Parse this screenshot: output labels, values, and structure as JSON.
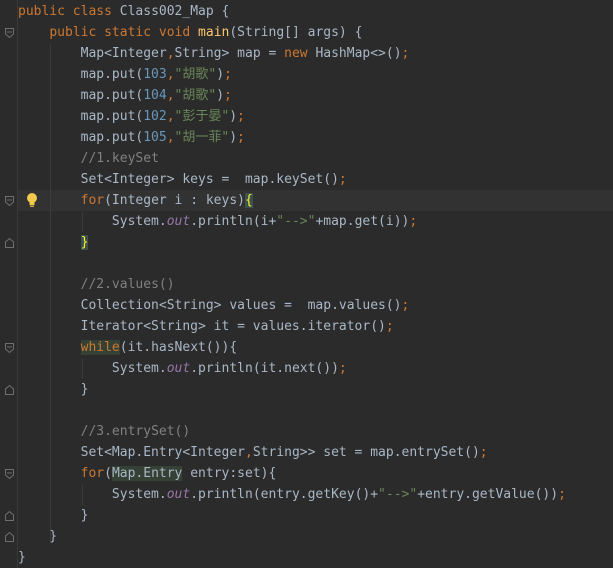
{
  "editor": {
    "lines": [
      [
        {
          "t": "public ",
          "c": "kw"
        },
        {
          "t": "class ",
          "c": "kw"
        },
        {
          "t": "Class002_Map {",
          "c": "df"
        }
      ],
      [
        {
          "t": "    "
        },
        {
          "t": "public ",
          "c": "kw"
        },
        {
          "t": "static ",
          "c": "kw"
        },
        {
          "t": "void ",
          "c": "kw"
        },
        {
          "t": "main",
          "c": "fn"
        },
        {
          "t": "(String[] args) {",
          "c": "df"
        }
      ],
      [
        {
          "t": "        Map<Integer",
          "c": "df"
        },
        {
          "t": ",",
          "c": "kw"
        },
        {
          "t": "String> map = ",
          "c": "df"
        },
        {
          "t": "new ",
          "c": "kw"
        },
        {
          "t": "HashMap<>()",
          "c": "df"
        },
        {
          "t": ";",
          "c": "kw"
        }
      ],
      [
        {
          "t": "        map.put(",
          "c": "df"
        },
        {
          "t": "103",
          "c": "num"
        },
        {
          "t": ",",
          "c": "kw"
        },
        {
          "t": "\"胡歌\"",
          "c": "str"
        },
        {
          "t": ")",
          "c": "df"
        },
        {
          "t": ";",
          "c": "kw"
        }
      ],
      [
        {
          "t": "        map.put(",
          "c": "df"
        },
        {
          "t": "104",
          "c": "num"
        },
        {
          "t": ",",
          "c": "kw"
        },
        {
          "t": "\"胡歌\"",
          "c": "str"
        },
        {
          "t": ")",
          "c": "df"
        },
        {
          "t": ";",
          "c": "kw"
        }
      ],
      [
        {
          "t": "        map.put(",
          "c": "df"
        },
        {
          "t": "102",
          "c": "num"
        },
        {
          "t": ",",
          "c": "kw"
        },
        {
          "t": "\"彭于晏\"",
          "c": "str"
        },
        {
          "t": ")",
          "c": "df"
        },
        {
          "t": ";",
          "c": "kw"
        }
      ],
      [
        {
          "t": "        map.put(",
          "c": "df"
        },
        {
          "t": "105",
          "c": "num"
        },
        {
          "t": ",",
          "c": "kw"
        },
        {
          "t": "\"胡一菲\"",
          "c": "str"
        },
        {
          "t": ")",
          "c": "df"
        },
        {
          "t": ";",
          "c": "kw"
        }
      ],
      [
        {
          "t": "        "
        },
        {
          "t": "//1.keySet",
          "c": "cm"
        }
      ],
      [
        {
          "t": "        Set<Integer> keys =  map.keySet()",
          "c": "df"
        },
        {
          "t": ";",
          "c": "kw"
        }
      ],
      [
        {
          "t": "        "
        },
        {
          "t": "for",
          "c": "kw"
        },
        {
          "t": "(Integer i : keys)",
          "c": "df"
        },
        {
          "t": "{",
          "c": "brace-match"
        }
      ],
      [
        {
          "t": "            System.",
          "c": "df"
        },
        {
          "t": "out",
          "c": "st"
        },
        {
          "t": ".println(i+",
          "c": "df"
        },
        {
          "t": "\"-->\"",
          "c": "str"
        },
        {
          "t": "+map.get(i))",
          "c": "df"
        },
        {
          "t": ";",
          "c": "kw"
        }
      ],
      [
        {
          "t": "        "
        },
        {
          "t": "}",
          "c": "brace-match"
        }
      ],
      [
        {
          "t": ""
        }
      ],
      [
        {
          "t": "        "
        },
        {
          "t": "//2.values()",
          "c": "cm"
        }
      ],
      [
        {
          "t": "        Collection<String> values =  map.values()",
          "c": "df"
        },
        {
          "t": ";",
          "c": "kw"
        }
      ],
      [
        {
          "t": "        Iterator<String> it = values.iterator()",
          "c": "df"
        },
        {
          "t": ";",
          "c": "kw"
        }
      ],
      [
        {
          "t": "        "
        },
        {
          "t": "while",
          "c": "kw usage"
        },
        {
          "t": "(it.hasNext()){",
          "c": "df"
        }
      ],
      [
        {
          "t": "            System.",
          "c": "df"
        },
        {
          "t": "out",
          "c": "st"
        },
        {
          "t": ".println(it.next())",
          "c": "df"
        },
        {
          "t": ";",
          "c": "kw"
        }
      ],
      [
        {
          "t": "        }",
          "c": "df"
        }
      ],
      [
        {
          "t": ""
        }
      ],
      [
        {
          "t": "        "
        },
        {
          "t": "//3.entrySet()",
          "c": "cm"
        }
      ],
      [
        {
          "t": "        Set<Map.Entry<Integer",
          "c": "df"
        },
        {
          "t": ",",
          "c": "kw"
        },
        {
          "t": "String>> set = map.entrySet()",
          "c": "df"
        },
        {
          "t": ";",
          "c": "kw"
        }
      ],
      [
        {
          "t": "        "
        },
        {
          "t": "for",
          "c": "kw"
        },
        {
          "t": "(",
          "c": "df"
        },
        {
          "t": "Map.Entry",
          "c": "df usage"
        },
        {
          "t": " entry:set){",
          "c": "df"
        }
      ],
      [
        {
          "t": "            System.",
          "c": "df"
        },
        {
          "t": "out",
          "c": "st"
        },
        {
          "t": ".println(entry.getKey()+",
          "c": "df"
        },
        {
          "t": "\"-->\"",
          "c": "str"
        },
        {
          "t": "+entry.getValue())",
          "c": "df"
        },
        {
          "t": ";",
          "c": "kw"
        }
      ],
      [
        {
          "t": "        }",
          "c": "df"
        }
      ],
      [
        {
          "t": "    }",
          "c": "df"
        }
      ],
      [
        {
          "t": "}",
          "c": "df"
        }
      ]
    ]
  },
  "gutter": {
    "fold_markers": [
      {
        "line": 1,
        "kind": "open"
      },
      {
        "line": 9,
        "kind": "open"
      },
      {
        "line": 11,
        "kind": "close"
      },
      {
        "line": 16,
        "kind": "open"
      },
      {
        "line": 18,
        "kind": "close"
      },
      {
        "line": 22,
        "kind": "open"
      },
      {
        "line": 24,
        "kind": "close"
      },
      {
        "line": 25,
        "kind": "close"
      }
    ],
    "intention_icon": "lightbulb-icon"
  },
  "colors": {
    "background": "#2b2b2b",
    "keyword": "#cc7832",
    "function": "#ffc66d",
    "number": "#6897bb",
    "string": "#6a8759",
    "comment": "#808080",
    "static_field": "#9876aa",
    "default": "#a9b7c6",
    "brace_match": "#ffef28"
  }
}
